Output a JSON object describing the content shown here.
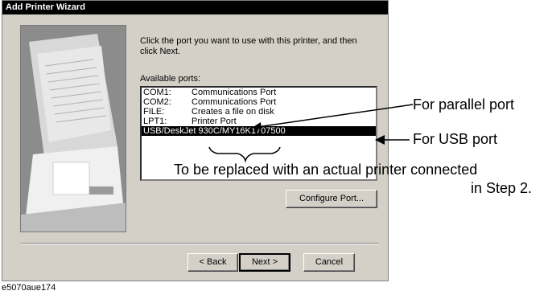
{
  "window": {
    "title": "Add Printer Wizard"
  },
  "instructions": "Click the port you want to use with this printer, and then click Next.",
  "ports_label": "Available ports:",
  "ports": [
    {
      "name": "COM1:",
      "desc": "Communications Port"
    },
    {
      "name": "COM2:",
      "desc": "Communications Port"
    },
    {
      "name": "FILE:",
      "desc": "Creates a file on disk"
    },
    {
      "name": "LPT1:",
      "desc": "Printer Port"
    },
    {
      "name": "USB/DeskJet  930C/MY16K1707500",
      "desc": "",
      "selected": true
    }
  ],
  "buttons": {
    "configure": "Configure Port...",
    "back": "< Back",
    "next": "Next >",
    "cancel": "Cancel"
  },
  "annotations": {
    "parallel": "For parallel port",
    "usb": "For USB port",
    "replace_line1": "To be replaced with an actual printer connected",
    "replace_line2": "in Step 2."
  },
  "caption": "e5070aue174",
  "colors": {
    "dialog_bg": "#d4d0c8",
    "titlebar": "#000000",
    "selection": "#000000"
  }
}
